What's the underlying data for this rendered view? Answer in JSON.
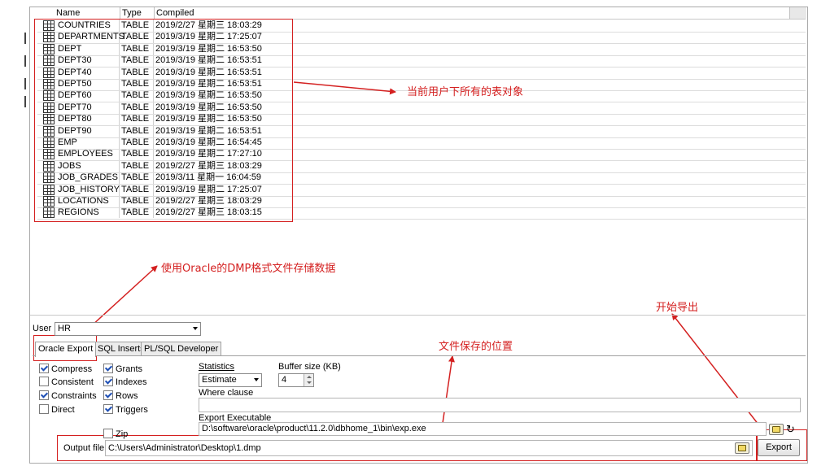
{
  "object_list": {
    "columns": [
      "Name",
      "Type",
      "Compiled"
    ],
    "rows": [
      {
        "name": "COUNTRIES",
        "type": "TABLE",
        "compiled": "2019/2/27 星期三 18:03:29"
      },
      {
        "name": "DEPARTMENTS",
        "type": "TABLE",
        "compiled": "2019/3/19 星期二 17:25:07"
      },
      {
        "name": "DEPT",
        "type": "TABLE",
        "compiled": "2019/3/19 星期二 16:53:50"
      },
      {
        "name": "DEPT30",
        "type": "TABLE",
        "compiled": "2019/3/19 星期二 16:53:51"
      },
      {
        "name": "DEPT40",
        "type": "TABLE",
        "compiled": "2019/3/19 星期二 16:53:51"
      },
      {
        "name": "DEPT50",
        "type": "TABLE",
        "compiled": "2019/3/19 星期二 16:53:51"
      },
      {
        "name": "DEPT60",
        "type": "TABLE",
        "compiled": "2019/3/19 星期二 16:53:50"
      },
      {
        "name": "DEPT70",
        "type": "TABLE",
        "compiled": "2019/3/19 星期二 16:53:50"
      },
      {
        "name": "DEPT80",
        "type": "TABLE",
        "compiled": "2019/3/19 星期二 16:53:50"
      },
      {
        "name": "DEPT90",
        "type": "TABLE",
        "compiled": "2019/3/19 星期二 16:53:51"
      },
      {
        "name": "EMP",
        "type": "TABLE",
        "compiled": "2019/3/19 星期二 16:54:45"
      },
      {
        "name": "EMPLOYEES",
        "type": "TABLE",
        "compiled": "2019/3/19 星期二 17:27:10"
      },
      {
        "name": "JOBS",
        "type": "TABLE",
        "compiled": "2019/2/27 星期三 18:03:29"
      },
      {
        "name": "JOB_GRADES",
        "type": "TABLE",
        "compiled": "2019/3/11 星期一 16:04:59"
      },
      {
        "name": "JOB_HISTORY",
        "type": "TABLE",
        "compiled": "2019/3/19 星期二 17:25:07"
      },
      {
        "name": "LOCATIONS",
        "type": "TABLE",
        "compiled": "2019/2/27 星期三 18:03:29"
      },
      {
        "name": "REGIONS",
        "type": "TABLE",
        "compiled": "2019/2/27 星期三 18:03:15"
      }
    ],
    "row_icon": "table-icon"
  },
  "user": {
    "label": "User",
    "value": "HR"
  },
  "tabs": [
    {
      "label": "Oracle Export",
      "active": true
    },
    {
      "label": "SQL Inserts",
      "active": false
    },
    {
      "label": "PL/SQL Developer",
      "active": false
    }
  ],
  "options": {
    "compress": {
      "label": "Compress",
      "checked": true
    },
    "consistent": {
      "label": "Consistent",
      "checked": false
    },
    "constraints": {
      "label": "Constraints",
      "checked": true
    },
    "direct": {
      "label": "Direct",
      "checked": false
    },
    "grants": {
      "label": "Grants",
      "checked": true
    },
    "indexes": {
      "label": "Indexes",
      "checked": true
    },
    "rows": {
      "label": "Rows",
      "checked": true
    },
    "triggers": {
      "label": "Triggers",
      "checked": true
    },
    "zip": {
      "label": "Zip",
      "checked": false
    }
  },
  "statistics": {
    "label": "Statistics",
    "value": "Estimate"
  },
  "buffer": {
    "label": "Buffer size (KB)",
    "value": "4"
  },
  "where_clause": {
    "label": "Where clause",
    "value": ""
  },
  "export_executable": {
    "label": "Export Executable",
    "value": "D:\\software\\oracle\\product\\11.2.0\\dbhome_1\\bin\\exp.exe"
  },
  "output_file": {
    "label": "Output file",
    "value": "C:\\Users\\Administrator\\Desktop\\1.dmp"
  },
  "export_button": {
    "label": "Export"
  },
  "refresh_glyph": "↻",
  "annotations": {
    "tables_note": "当前用户下所有的表对象",
    "dmp_note": "使用Oracle的DMP格式文件存储数据",
    "start_export_note": "开始导出",
    "file_location_note": "文件保存的位置",
    "color": "#d42020"
  }
}
